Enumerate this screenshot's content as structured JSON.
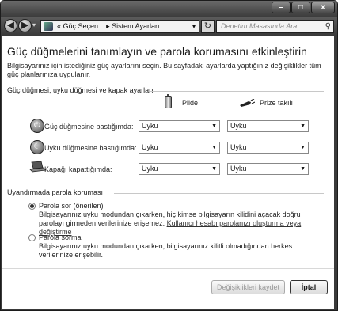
{
  "window": {
    "controls": {
      "minimize": "–",
      "maximize": "□",
      "close": "x"
    }
  },
  "nav": {
    "back": "◀",
    "forward": "▶",
    "address": {
      "prefix": "«",
      "crumb1": "Güç Seçen...",
      "sep": "▸",
      "crumb2": "Sistem Ayarları"
    },
    "refresh": "↻",
    "search_placeholder": "Denetim Masasında Ara"
  },
  "page": {
    "title": "Güç düğmelerini tanımlayın ve parola korumasını etkinleştirin",
    "description": "Bilgisayarınız için istediğiniz güç ayarlarını seçin. Bu sayfadaki ayarlarda yaptığınız değişiklikler tüm güç planlarınıza uygulanır."
  },
  "buttons_section": {
    "header": "Güç düğmesi, uyku düğmesi ve kapak ayarları",
    "col_battery": "Pilde",
    "col_plugged": "Prize takılı",
    "rows": [
      {
        "label": "Güç düğmesine bastığımda:",
        "battery": "Uyku",
        "plugged": "Uyku",
        "icon": "power-icon"
      },
      {
        "label": "Uyku düğmesine bastığımda:",
        "battery": "Uyku",
        "plugged": "Uyku",
        "icon": "sleep-icon"
      },
      {
        "label": "Kapağı kapattığımda:",
        "battery": "Uyku",
        "plugged": "Uyku",
        "icon": "laptop-lid-icon"
      }
    ]
  },
  "password_section": {
    "header": "Uyandırmada parola koruması",
    "options": [
      {
        "title": "Parola sor (önerilen)",
        "selected": true,
        "desc": "Bilgisayarınız uyku modundan çıkarken, hiç kimse bilgisayarın kilidini açacak doğru parolayı girmeden verilerinize erişemez.",
        "link": "Kullanıcı hesabı parolanızı oluşturma veya değiştirme"
      },
      {
        "title": "Parola sorma",
        "selected": false,
        "desc": "Bilgisayarınız uyku modundan çıkarken, bilgisayarınız kilitli olmadığından herkes verilerinize erişebilir."
      }
    ]
  },
  "footer": {
    "save": "Değişiklikleri kaydet",
    "cancel": "İptal"
  },
  "colors": {
    "chrome": "#3a3a3a",
    "content_bg": "#ffffff",
    "disabled_text": "#9a9a9a"
  }
}
